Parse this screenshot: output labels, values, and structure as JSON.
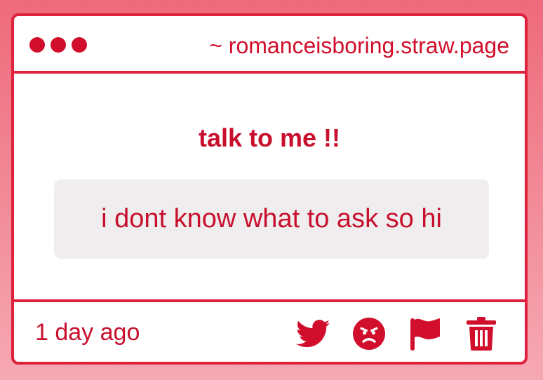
{
  "window": {
    "url": "~ romanceisboring.straw.page"
  },
  "card": {
    "prompt": "talk to me !!",
    "message": "i dont know what to ask so hi"
  },
  "footer": {
    "timestamp": "1 day ago",
    "actions": [
      {
        "icon": "twitter-icon"
      },
      {
        "icon": "angry-face-icon"
      },
      {
        "icon": "flag-icon"
      },
      {
        "icon": "trash-icon"
      }
    ]
  },
  "colors": {
    "accent": "#d10f2c",
    "border": "#e0213b",
    "message_bg": "#efeded",
    "page_bg": "#f28c99"
  }
}
